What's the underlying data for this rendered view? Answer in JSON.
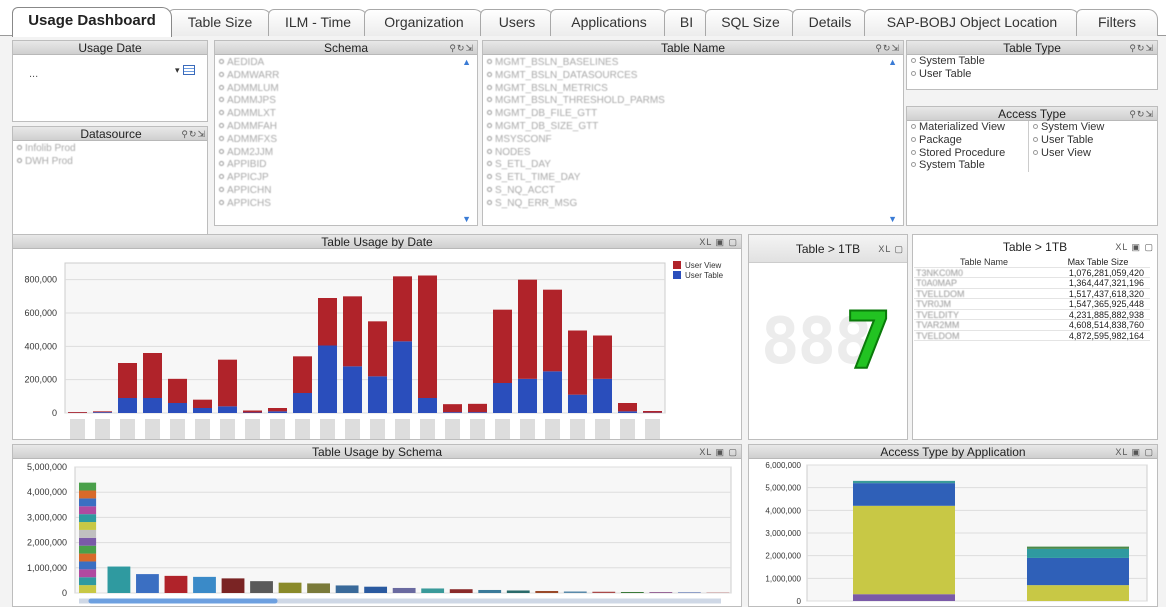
{
  "tabs": [
    "Usage Dashboard",
    "Table Size",
    "ILM - Time",
    "Organization",
    "Users",
    "Applications",
    "BI",
    "SQL Size",
    "Details",
    "SAP-BOBJ Object Location",
    "Filters"
  ],
  "usage_date": {
    "title": "Usage Date",
    "value": "..."
  },
  "datasource": {
    "title": "Datasource",
    "items": [
      "Infolib Prod",
      "DWH Prod"
    ]
  },
  "schema": {
    "title": "Schema",
    "items": [
      "AEDIDA",
      "ADMWARR",
      "ADMMLUM",
      "ADMMJPS",
      "ADMMLXT",
      "ADMMFAH",
      "ADMMFXS",
      "ADM2JJM",
      "APPIBID",
      "APPICJP",
      "APPICHN",
      "APPICHS"
    ]
  },
  "table_name": {
    "title": "Table Name",
    "items": [
      "MGMT_BSLN_BASELINES",
      "MGMT_BSLN_DATASOURCES",
      "MGMT_BSLN_METRICS",
      "MGMT_BSLN_THRESHOLD_PARMS",
      "MGMT_DB_FILE_GTT",
      "MGMT_DB_SIZE_GTT",
      "MSYSCONF",
      "NODES",
      "S_ETL_DAY",
      "S_ETL_TIME_DAY",
      "S_NQ_ACCT",
      "S_NQ_ERR_MSG"
    ]
  },
  "table_type": {
    "title": "Table Type",
    "items": [
      "System Table",
      "User Table"
    ]
  },
  "access_type": {
    "title": "Access Type",
    "col1": [
      "Materialized View",
      "Package",
      "Stored Procedure",
      "System Table"
    ],
    "col2": [
      "System View",
      "User Table",
      "User View"
    ]
  },
  "usage_by_date": {
    "title": "Table Usage by Date",
    "chart_data": {
      "type": "bar",
      "stacked": true,
      "series": [
        {
          "name": "User View",
          "color": "#b0232a",
          "values": [
            5000,
            5000,
            210000,
            270000,
            145000,
            50000,
            280000,
            12000,
            20000,
            220000,
            285000,
            420000,
            330000,
            390000,
            735000,
            48000,
            50000,
            440000,
            595000,
            490000,
            385000,
            260000,
            50000,
            10000
          ]
        },
        {
          "name": "User Table",
          "color": "#2a4ebc",
          "values": [
            1000,
            5000,
            90000,
            90000,
            60000,
            30000,
            40000,
            3000,
            10000,
            120000,
            405000,
            280000,
            220000,
            430000,
            90000,
            5000,
            5000,
            180000,
            205000,
            250000,
            110000,
            205000,
            10000,
            2000
          ]
        }
      ],
      "ylim": [
        0,
        900000
      ],
      "yticks": [
        "0",
        "200,000",
        "400,000",
        "600,000",
        "800,000"
      ],
      "legend": "top-right"
    }
  },
  "table_gt_1tb_count": {
    "title": "Table > 1TB",
    "value": "7",
    "ghost": "888"
  },
  "table_gt_1tb_list": {
    "title": "Table > 1TB",
    "headers": [
      "Table Name",
      "Max Table Size"
    ],
    "rows": [
      [
        "T3NKC0M0",
        "1,076,281,059,420"
      ],
      [
        "T0A0MAP",
        "1,364,447,321,196"
      ],
      [
        "TVELLDOM",
        "1,517,437,618,320"
      ],
      [
        "TVR0JM",
        "1,547,365,925,448"
      ],
      [
        "TVELDITY",
        "4,231,885,882,938"
      ],
      [
        "TVAR2MM",
        "4,608,514,838,760"
      ],
      [
        "TVELDOM",
        "4,872,595,982,164"
      ]
    ]
  },
  "usage_by_schema": {
    "title": "Table Usage by Schema",
    "chart_data": {
      "type": "bar",
      "stacked": true,
      "values": [
        4380000,
        1050000,
        750000,
        680000,
        640000,
        580000,
        470000,
        410000,
        380000,
        300000,
        250000,
        200000,
        180000,
        150000,
        120000,
        100000,
        80000,
        60000,
        50000,
        40000,
        30000,
        20000,
        10000
      ],
      "ylim": [
        0,
        5000000
      ],
      "yticks": [
        "0",
        "1,000,000",
        "2,000,000",
        "3,000,000",
        "4,000,000",
        "5,000,000"
      ]
    }
  },
  "access_by_app": {
    "title": "Access Type by Application",
    "chart_data": {
      "type": "bar",
      "stacked": true,
      "bars": [
        {
          "segments": [
            {
              "v": 300000,
              "c": "#7a5aa8"
            },
            {
              "v": 3900000,
              "c": "#c8c845"
            },
            {
              "v": 1000000,
              "c": "#2f60b8"
            },
            {
              "v": 100000,
              "c": "#3a9a9a"
            }
          ]
        },
        {
          "segments": [
            {
              "v": 700000,
              "c": "#c8c845"
            },
            {
              "v": 1200000,
              "c": "#2f60b8"
            },
            {
              "v": 400000,
              "c": "#2f9aa0"
            },
            {
              "v": 100000,
              "c": "#4a8a4a"
            }
          ]
        }
      ],
      "ylim": [
        0,
        6000000
      ],
      "yticks": [
        "0",
        "1,000,000",
        "2,000,000",
        "3,000,000",
        "4,000,000",
        "5,000,000",
        "6,000,000"
      ]
    }
  },
  "colors": {
    "accent": "#3a7bd5",
    "led": "#22c322"
  }
}
